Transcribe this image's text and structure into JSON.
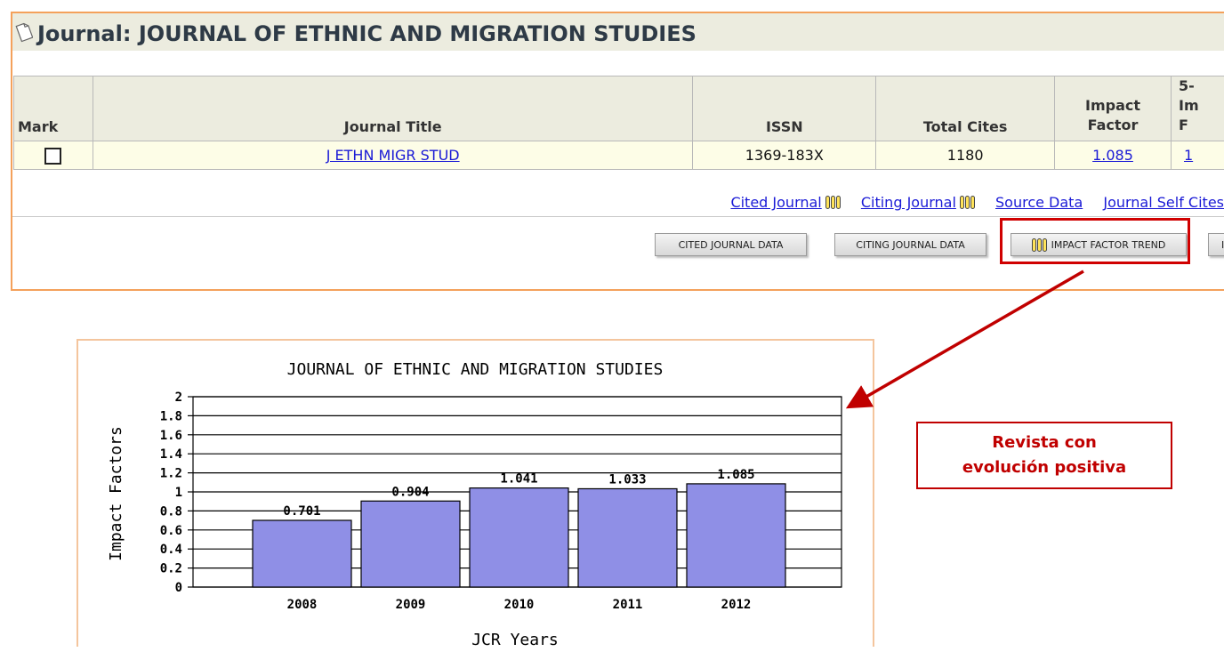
{
  "page": {
    "title_prefix": "Journal: ",
    "title_journal": "JOURNAL OF ETHNIC AND MIGRATION STUDIES"
  },
  "table": {
    "headers": {
      "mark": "Mark",
      "journal_title": "Journal Title",
      "issn": "ISSN",
      "total_cites": "Total Cites",
      "impact_factor_1": "Impact",
      "impact_factor_2": "Factor",
      "five_year_1": "5-",
      "five_year_2": "Im",
      "five_year_3": "F"
    },
    "row": {
      "journal_title": "J ETHN MIGR STUD",
      "issn": "1369-183X",
      "total_cites": "1180",
      "impact_factor": "1.085",
      "five_year": "1"
    }
  },
  "links": {
    "cited_journal": "Cited Journal",
    "citing_journal": "Citing Journal",
    "source_data": "Source Data",
    "journal_self_cites": "Journal Self Cites"
  },
  "buttons": {
    "cited_data": "CITED JOURNAL DATA",
    "citing_data": "CITING JOURNAL DATA",
    "impact_trend": "IMPACT FACTOR TREND",
    "next": "I"
  },
  "annotation": {
    "line1": "Revista con",
    "line2": "evolución positiva",
    "color": "#c00000"
  },
  "colors": {
    "accent_border": "#f4a15b",
    "link": "#1a1ad6",
    "header_bg": "#ececdf",
    "row_bg": "#fdfde7",
    "bar": "#8f8fe6"
  },
  "chart_data": {
    "type": "bar",
    "title": "JOURNAL OF ETHNIC AND MIGRATION STUDIES",
    "xlabel": "JCR Years",
    "ylabel": "Impact Factors",
    "categories": [
      "2008",
      "2009",
      "2010",
      "2011",
      "2012"
    ],
    "values": [
      0.701,
      0.904,
      1.041,
      1.033,
      1.085
    ],
    "value_labels": [
      "0.701",
      "0.904",
      "1.041",
      "1.033",
      "1.085"
    ],
    "yticks": [
      "0",
      "0.2",
      "0.4",
      "0.6",
      "0.8",
      "1",
      "1.2",
      "1.4",
      "1.6",
      "1.8",
      "2"
    ],
    "ylim": [
      0,
      2
    ],
    "grid": true,
    "legend": "none"
  }
}
